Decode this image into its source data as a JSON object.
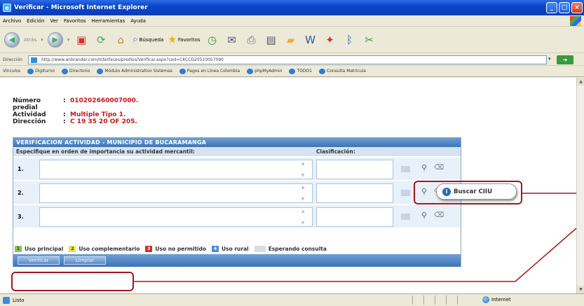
{
  "window": {
    "title": "Verificar - Microsoft Internet Explorer"
  },
  "menu": [
    "Archivo",
    "Edición",
    "Ver",
    "Favoritos",
    "Herramientas",
    "Ayuda"
  ],
  "toolbar": {
    "back_label": "Atrás",
    "search_label": "Búsqueda",
    "favorites_label": "Favoritos"
  },
  "address": {
    "label": "Dirección",
    "url": "http://www.anbrander.com/Interfaces/predios/Verificar.aspx?cod=CKCCD20510057090",
    "go_label": "Ir"
  },
  "links": {
    "label": "Vínculos",
    "items": [
      "Digiturno",
      "Directorio",
      "Módulo Administrativo Sistemas",
      "Pagos en Línea Colombia",
      "phpMyAdmin",
      "TODO1",
      "Consulta Matrícula"
    ]
  },
  "info": {
    "rows": [
      {
        "label": "Número predial",
        "value": "010202660007000."
      },
      {
        "label": "Actividad",
        "value": "Multiple Tipo 1."
      },
      {
        "label": "Dirección",
        "value": "C 19 35 20 OF 205."
      }
    ]
  },
  "panel": {
    "title": "VERIFICACION ACTIVIDAD - MUNICIPIO DE BUCARAMANGA",
    "col_activity": "Especifique en orden de importancia su actividad mercantil:",
    "col_classification": "Clasificación:",
    "rows": [
      "1.",
      "2.",
      "3."
    ]
  },
  "legend": [
    {
      "code": "1",
      "label": "Uso principal",
      "color": "#8fbf59"
    },
    {
      "code": "2",
      "label": "Uso complementario",
      "color": "#e9e04a"
    },
    {
      "code": "3",
      "label": "Uso no permitido",
      "color": "#d2302a"
    },
    {
      "code": "4",
      "label": "Uso rural",
      "color": "#4a8fd6"
    },
    {
      "code": "",
      "label": "Esperando consulta",
      "color": "#d8dde3"
    }
  ],
  "buttons": {
    "verify": "Verificar",
    "clear": "Limpiar"
  },
  "callout": {
    "label": "Buscar CIIU"
  },
  "status": {
    "left": "Listo",
    "zone": "Internet"
  }
}
